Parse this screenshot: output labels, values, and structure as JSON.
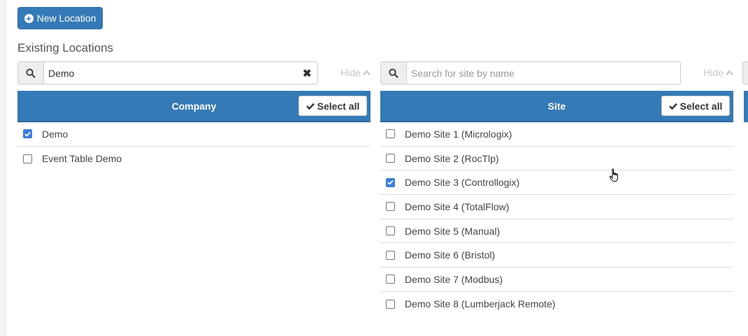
{
  "toolbar": {
    "new_location_label": "New Location"
  },
  "page": {
    "section_title": "Existing Locations"
  },
  "company_panel": {
    "search_value": "Demo",
    "search_placeholder": "",
    "hide_label": "Hide",
    "header": "Company",
    "select_all_label": "Select all",
    "items": [
      {
        "label": "Demo",
        "checked": true
      },
      {
        "label": "Event Table Demo",
        "checked": false
      }
    ]
  },
  "site_panel": {
    "search_value": "",
    "search_placeholder": "Search for site by name",
    "hide_label": "Hide",
    "header": "Site",
    "select_all_label": "Select all",
    "items": [
      {
        "label": "Demo Site 1 (Micrologix)",
        "checked": false
      },
      {
        "label": "Demo Site 2 (RocTlp)",
        "checked": false
      },
      {
        "label": "Demo Site 3 (Controllogix)",
        "checked": true
      },
      {
        "label": "Demo Site 4 (TotalFlow)",
        "checked": false
      },
      {
        "label": "Demo Site 5 (Manual)",
        "checked": false
      },
      {
        "label": "Demo Site 6 (Bristol)",
        "checked": false
      },
      {
        "label": "Demo Site 7 (Modbus)",
        "checked": false
      },
      {
        "label": "Demo Site 8 (Lumberjack Remote)",
        "checked": false
      }
    ]
  },
  "icons": {
    "search": "search-icon",
    "clear": "close-icon",
    "hide": "chevron-up-icon",
    "select_all": "check-icon",
    "new": "plus-circle-icon",
    "cursor": "hand-pointer-icon"
  },
  "colors": {
    "primary": "#337ab7",
    "checkbox_checked": "#3b7fd9",
    "muted": "#c7c7c7"
  }
}
